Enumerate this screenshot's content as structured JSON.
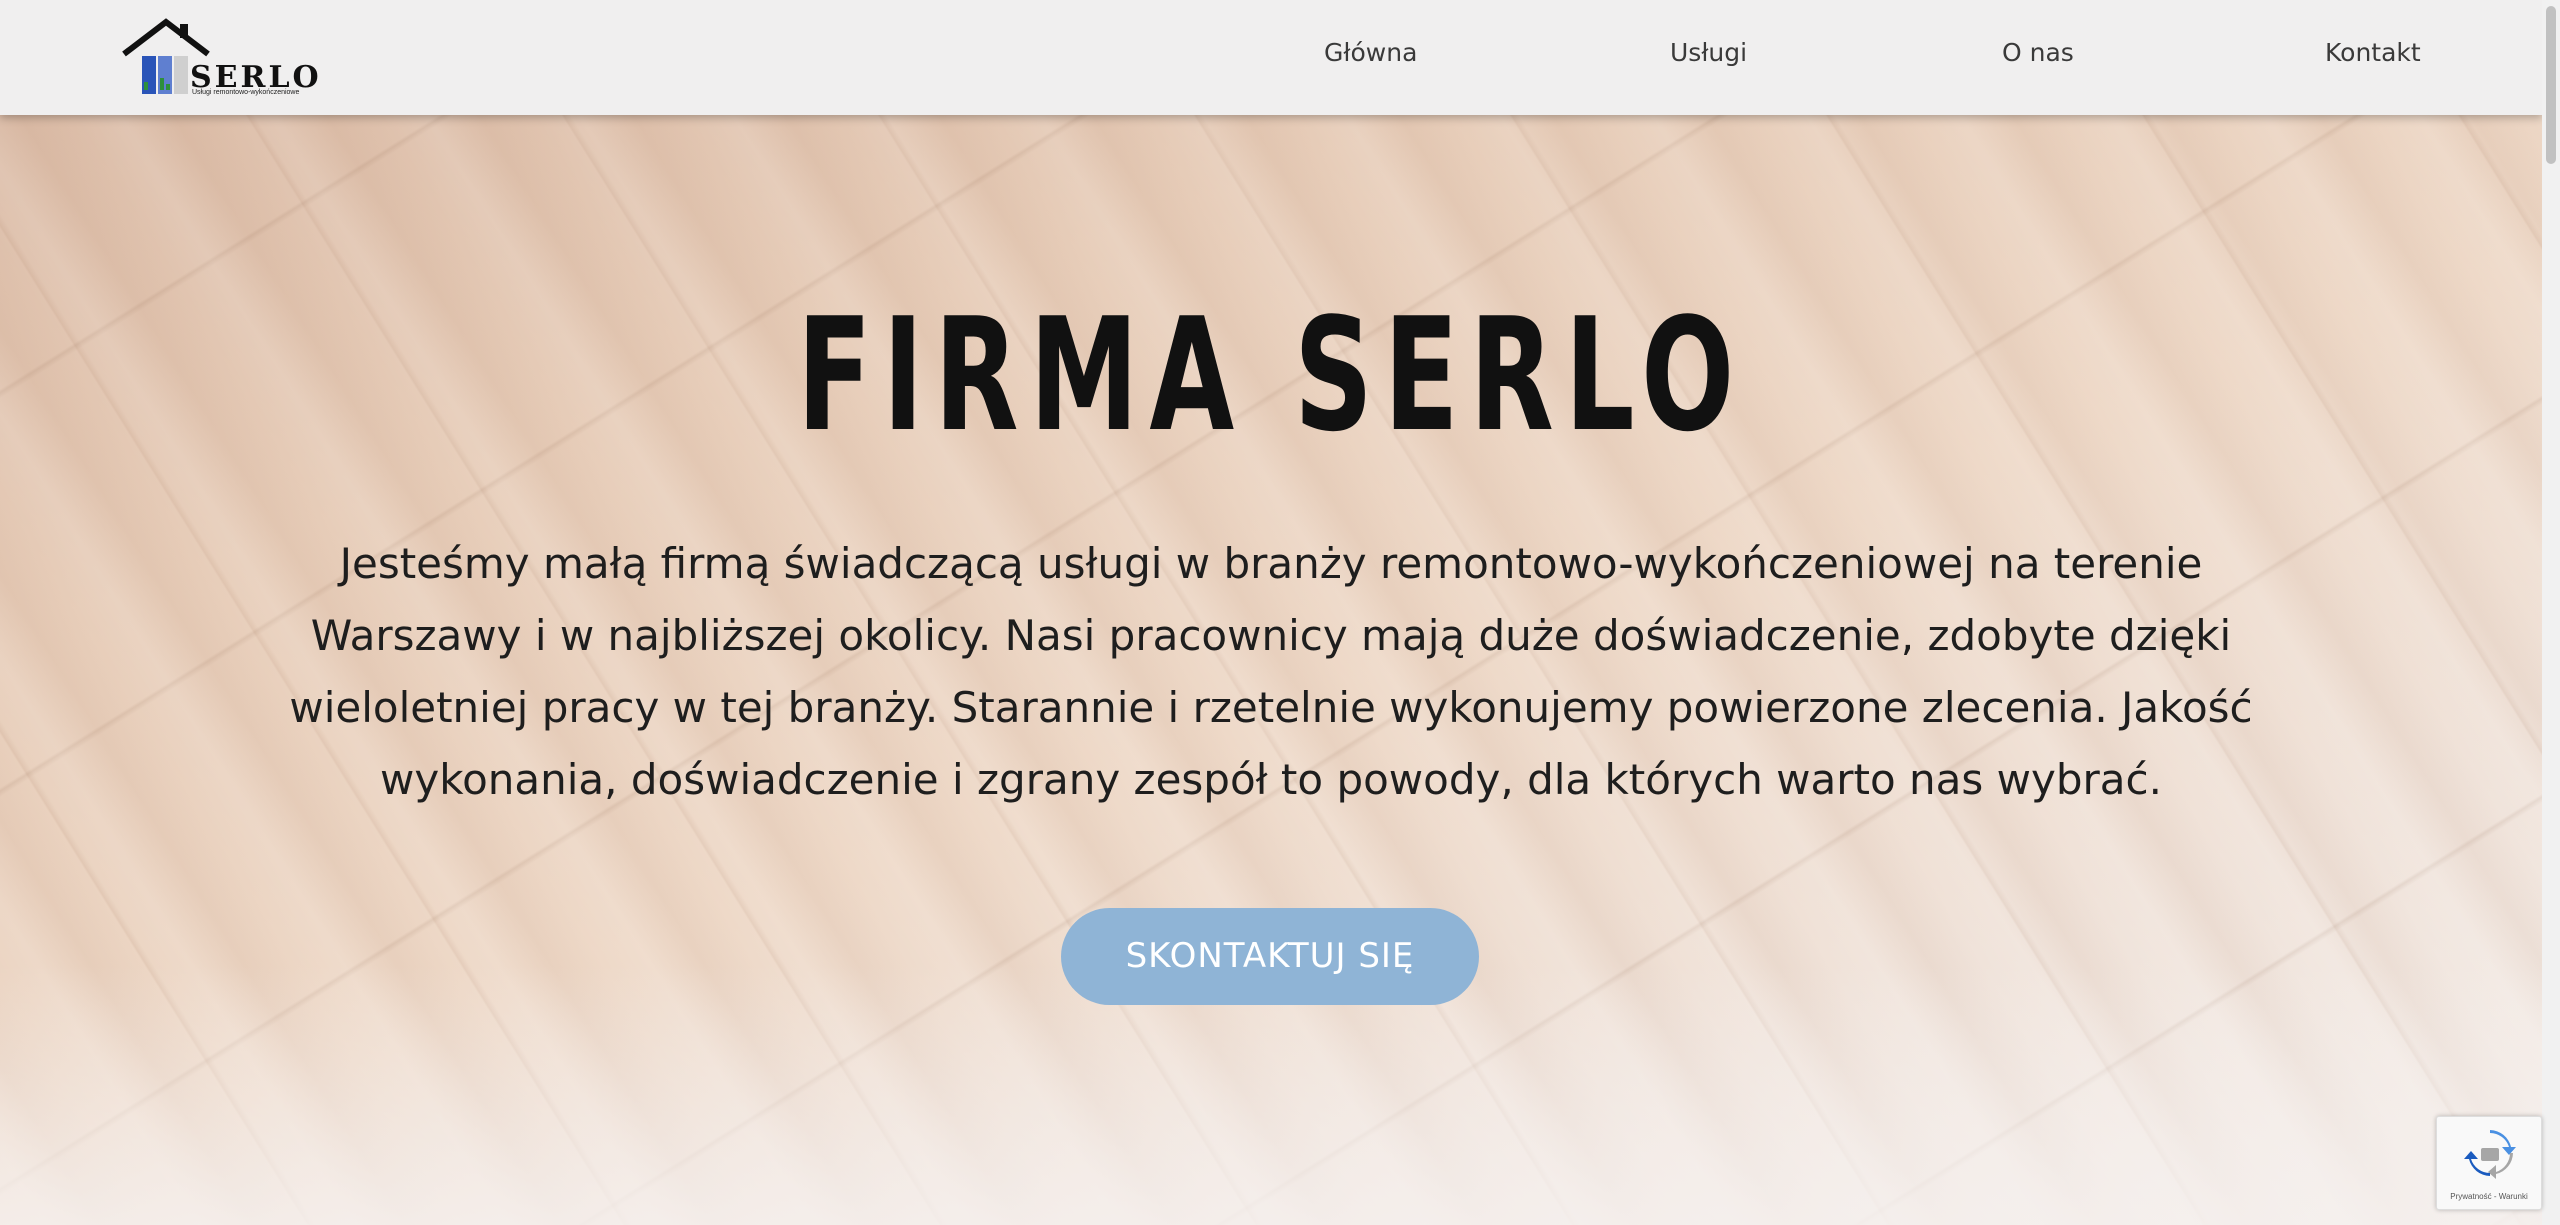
{
  "header": {
    "logo": {
      "name": "SERLO",
      "tagline": "Usługi remontowo-wykończeniowe",
      "icon": "house-roof-icon"
    },
    "nav": [
      {
        "label": "Główna"
      },
      {
        "label": "Usługi"
      },
      {
        "label": "O nas"
      },
      {
        "label": "Kontakt"
      }
    ]
  },
  "hero": {
    "title": "FIRMA SERLO",
    "intro_lines": [
      "Jesteśmy małą firmą świadczącą usługi w branży remontowo-wykończeniowej na terenie",
      "Warszawy i w najbliższej okolicy. Nasi pracownicy mają duże doświadczenie, zdobyte dzięki",
      "wieloletniej pracy w tej branży. Starannie i rzetelnie wykonujemy powierzone zlecenia. Jakość",
      "wykonania, doświadczenie i zgrany zespół to powody, dla których warto nas wybrać."
    ],
    "cta_label": "SKONTAKTUJ SIĘ"
  },
  "recaptcha": {
    "links": "Prywatność - Warunki",
    "icon": "recaptcha-icon"
  },
  "colors": {
    "cta_background": "#8fb4d6",
    "header_background": "#f0efef",
    "text": "#1e1e1e"
  }
}
